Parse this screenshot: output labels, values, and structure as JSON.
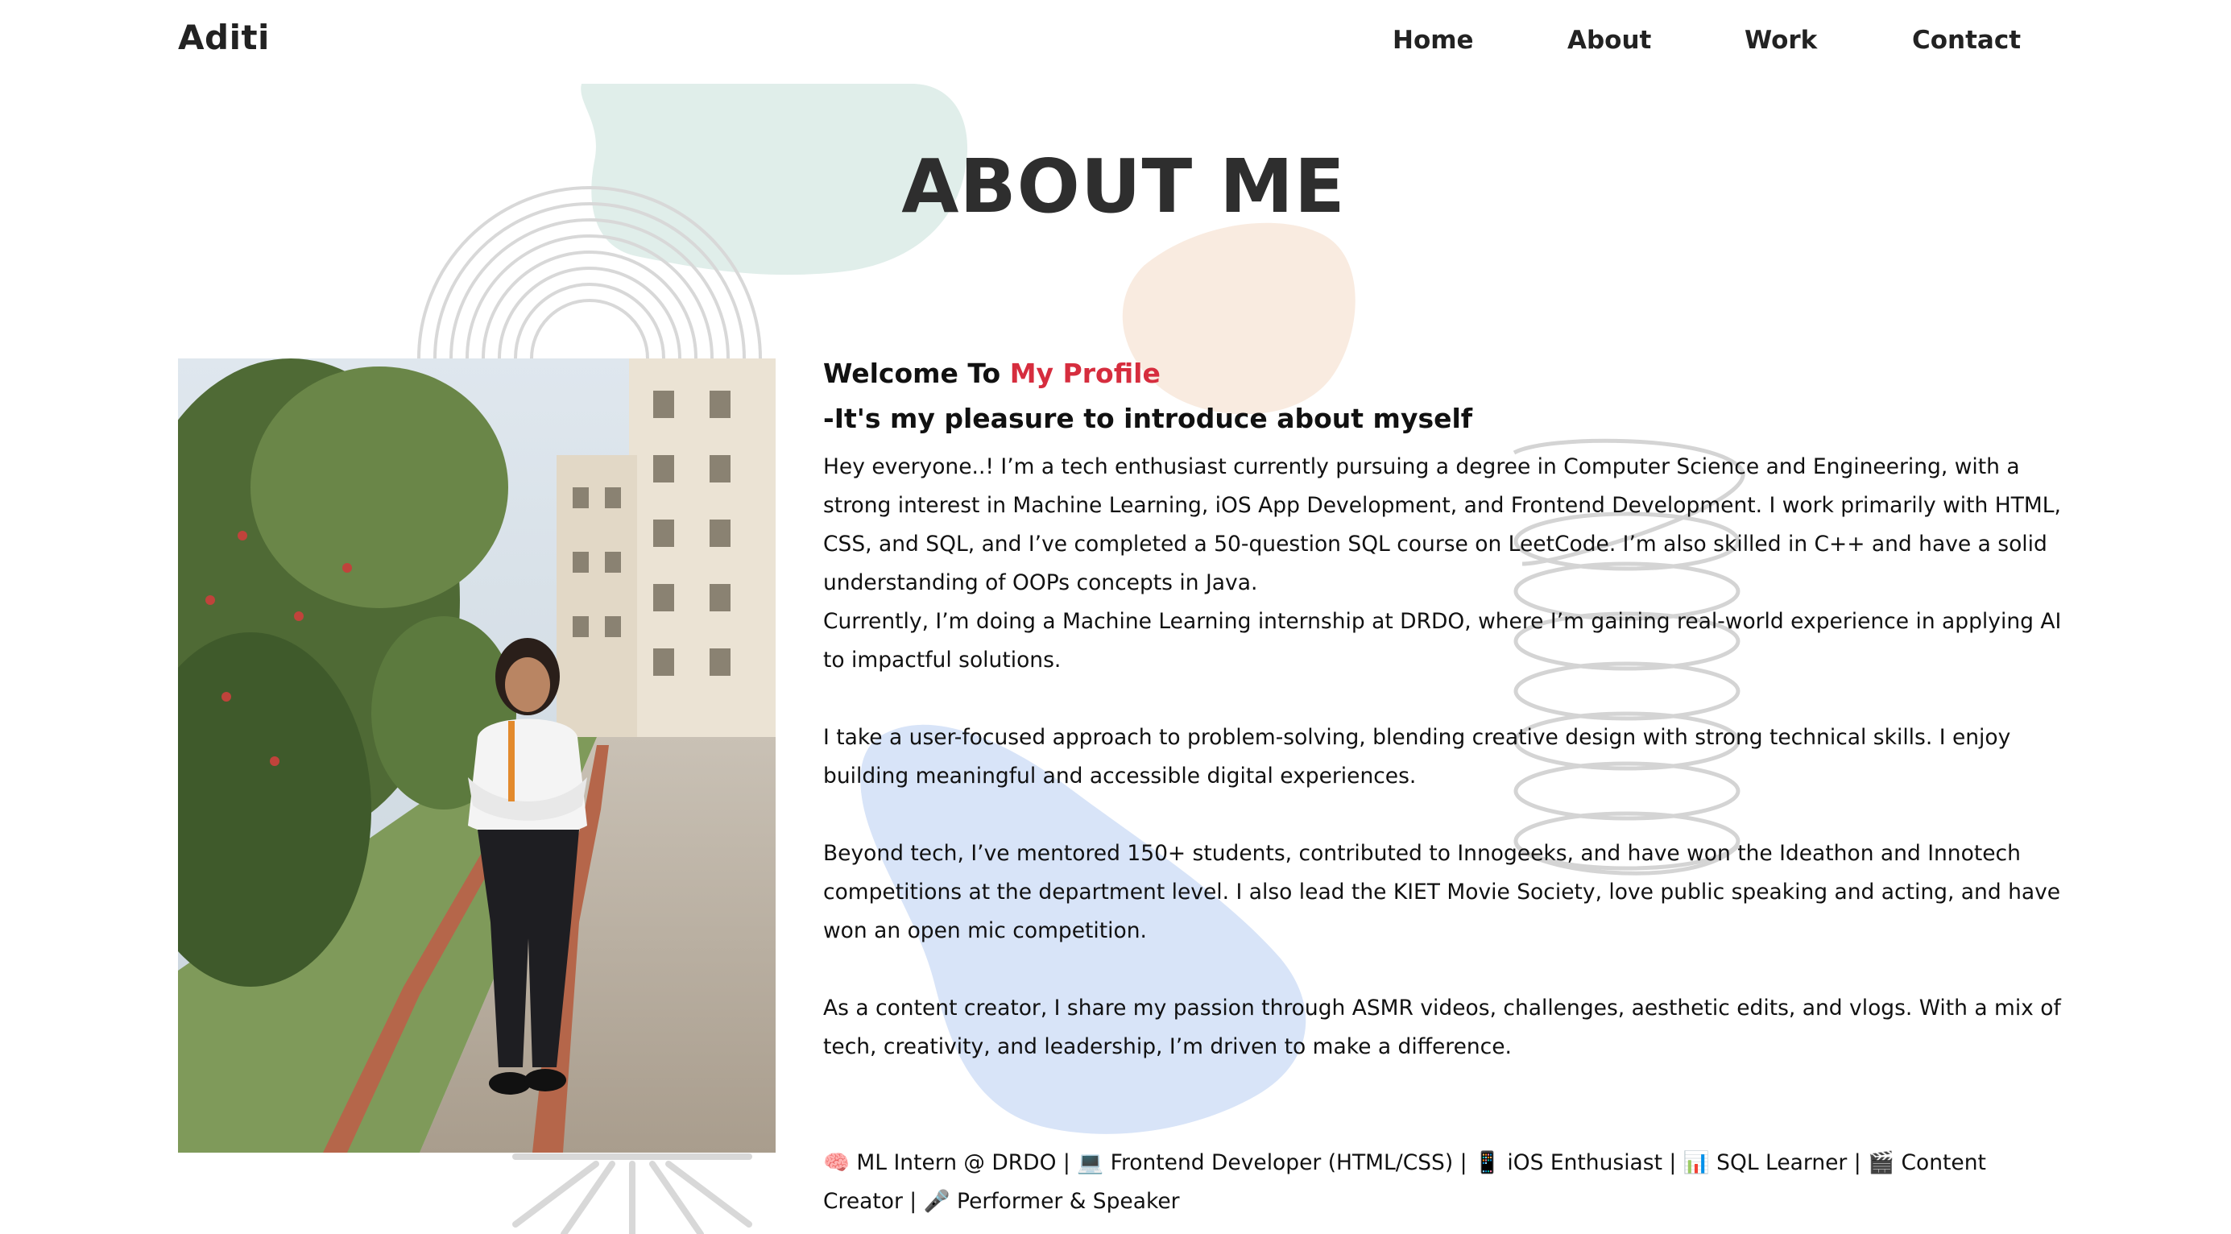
{
  "brand": {
    "name": "Aditi"
  },
  "nav": {
    "items": [
      {
        "label": "Home"
      },
      {
        "label": "About"
      },
      {
        "label": "Work"
      },
      {
        "label": "Contact"
      }
    ]
  },
  "page": {
    "title": "ABOUT ME"
  },
  "photo": {
    "icon": "profile-photo"
  },
  "about": {
    "welcome_prefix": "Welcome To",
    "welcome_accent": "My Profile",
    "subheading": "-It's my pleasure to introduce about myself",
    "p1": "Hey everyone..! I’m a tech enthusiast currently pursuing a degree in Computer Science and Engineering, with a strong interest in Machine Learning, iOS App Development, and Frontend Development. I work primarily with HTML, CSS, and SQL, and I’ve completed a 50-question SQL course on LeetCode. I’m also skilled in C++ and have a solid understanding of OOPs concepts in Java.",
    "p2": "Currently, I’m doing a Machine Learning internship at DRDO, where I’m gaining real-world experience in applying AI to impactful solutions.",
    "p3": "I take a user-focused approach to problem-solving, blending creative design with strong technical skills. I enjoy building meaningful and accessible digital experiences.",
    "p4": "Beyond tech, I’ve mentored 150+ students, contributed to Innogeeks, and have won the Ideathon and Innotech competitions at the department level. I also lead the KIET Movie Society, love public speaking and acting, and have won an open mic competition.",
    "p5": "As a content creator, I share my passion through ASMR videos, challenges, aesthetic edits, and vlogs. With a mix of tech, creativity, and leadership, I’m driven to make a difference.",
    "tags": "🧠 ML Intern @ DRDO | 💻 Frontend Developer (HTML/CSS) | 📱 iOS Enthusiast | 📊 SQL Learner | 🎬 Content Creator | 🎤 Performer & Speaker"
  },
  "colors": {
    "accent": "#d62d3e",
    "text": "#111111",
    "title": "#2e2e2e",
    "blob_mint": "#e0eeea",
    "blob_peach": "#f9ebe0",
    "blob_blue": "#d8e4f8",
    "line_gray": "#d8d8d8"
  }
}
